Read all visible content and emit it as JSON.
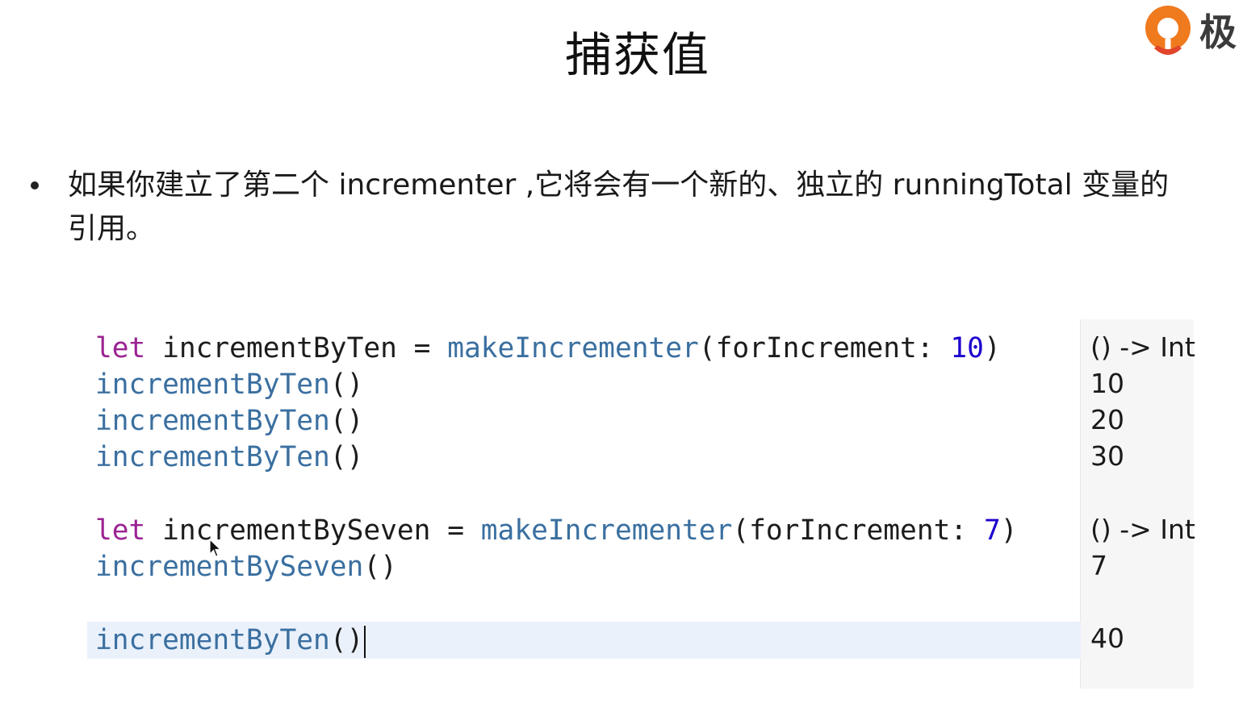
{
  "slide": {
    "title": "捕获值"
  },
  "logo": {
    "icon": "q-logo-icon",
    "text": "极",
    "colors": {
      "orange": "#f07a1e",
      "red": "#e2452b",
      "text": "#3b3b3b"
    }
  },
  "bullet": {
    "text": "如果你建立了第二个 incrementer ,它将会有一个新的、独立的 runningTotal 变量的引用。"
  },
  "code": {
    "lines": [
      {
        "kw": "let",
        "id": "incrementByTen",
        "eq": "=",
        "fn": "makeIncrementer",
        "open": "(",
        "param": "forIncrement:",
        "num": "10",
        "close": ")",
        "result": "() -> Int"
      },
      {
        "fn": "incrementByTen",
        "parens": "()",
        "result": "10"
      },
      {
        "fn": "incrementByTen",
        "parens": "()",
        "result": "20"
      },
      {
        "fn": "incrementByTen",
        "parens": "()",
        "result": "30"
      },
      {
        "kw": "let",
        "id": "incrementBySeven",
        "eq": "=",
        "fn": "makeIncrementer",
        "open": "(",
        "param": "forIncrement:",
        "num": "7",
        "close": ")",
        "result": "() -> Int"
      },
      {
        "fn": "incrementBySeven",
        "parens": "()",
        "result": "7"
      },
      {
        "fn": "incrementByTen",
        "parens": "()",
        "result": "40"
      }
    ],
    "colors": {
      "keyword": "#9b2393",
      "function": "#3a6fa0",
      "number": "#1c00cf",
      "highlight": "#eaf1fb",
      "results_bg": "#f6f6f6"
    }
  }
}
